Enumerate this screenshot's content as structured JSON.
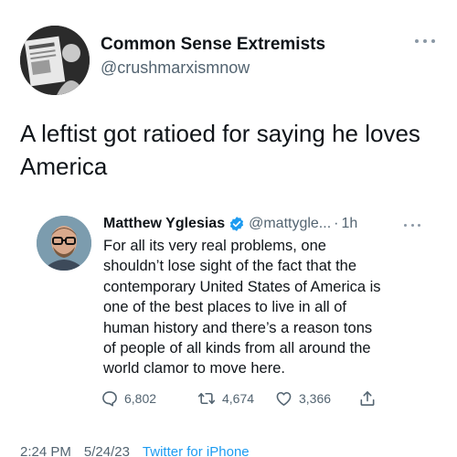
{
  "author": {
    "name": "Common Sense Extremists",
    "handle": "@crushmarxismnow",
    "avatar_icon": "newspaper-photo-avatar"
  },
  "tweet": {
    "text": "A leftist got ratioed for saying he loves America"
  },
  "quoted": {
    "name": "Matthew Yglesias",
    "handle": "@mattygle...",
    "separator": "·",
    "time": "1h",
    "verified": true,
    "lines": [
      "For all its very real problems, one",
      "shouldn’t lose sight of the fact that the",
      "contemporary United States of America is",
      "one of the best places to live in all of",
      "human history and there’s a reason tons",
      "of people of all kinds from all around the",
      "world clamor to move here."
    ],
    "stats": {
      "replies": "6,802",
      "retweets": "4,674",
      "likes": "3,366"
    }
  },
  "footer": {
    "time": "2:24 PM",
    "date": "5/24/23",
    "source": "Twitter for iPhone"
  },
  "colors": {
    "accent": "#1d9bf0",
    "muted": "#536471",
    "text": "#0f1419"
  }
}
